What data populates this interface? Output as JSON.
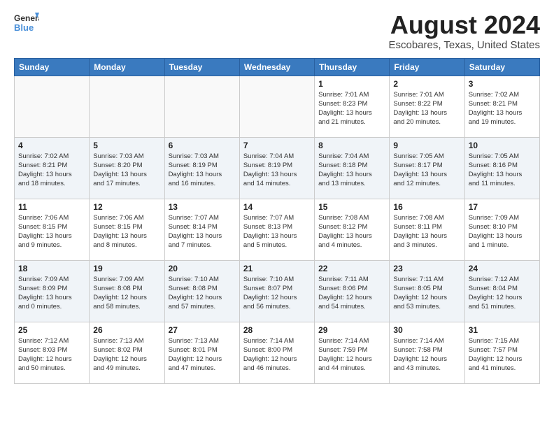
{
  "header": {
    "logo_general": "General",
    "logo_blue": "Blue",
    "title": "August 2024",
    "subtitle": "Escobares, Texas, United States"
  },
  "days_of_week": [
    "Sunday",
    "Monday",
    "Tuesday",
    "Wednesday",
    "Thursday",
    "Friday",
    "Saturday"
  ],
  "weeks": [
    [
      {
        "day": "",
        "info": ""
      },
      {
        "day": "",
        "info": ""
      },
      {
        "day": "",
        "info": ""
      },
      {
        "day": "",
        "info": ""
      },
      {
        "day": "1",
        "info": "Sunrise: 7:01 AM\nSunset: 8:23 PM\nDaylight: 13 hours\nand 21 minutes."
      },
      {
        "day": "2",
        "info": "Sunrise: 7:01 AM\nSunset: 8:22 PM\nDaylight: 13 hours\nand 20 minutes."
      },
      {
        "day": "3",
        "info": "Sunrise: 7:02 AM\nSunset: 8:21 PM\nDaylight: 13 hours\nand 19 minutes."
      }
    ],
    [
      {
        "day": "4",
        "info": "Sunrise: 7:02 AM\nSunset: 8:21 PM\nDaylight: 13 hours\nand 18 minutes."
      },
      {
        "day": "5",
        "info": "Sunrise: 7:03 AM\nSunset: 8:20 PM\nDaylight: 13 hours\nand 17 minutes."
      },
      {
        "day": "6",
        "info": "Sunrise: 7:03 AM\nSunset: 8:19 PM\nDaylight: 13 hours\nand 16 minutes."
      },
      {
        "day": "7",
        "info": "Sunrise: 7:04 AM\nSunset: 8:19 PM\nDaylight: 13 hours\nand 14 minutes."
      },
      {
        "day": "8",
        "info": "Sunrise: 7:04 AM\nSunset: 8:18 PM\nDaylight: 13 hours\nand 13 minutes."
      },
      {
        "day": "9",
        "info": "Sunrise: 7:05 AM\nSunset: 8:17 PM\nDaylight: 13 hours\nand 12 minutes."
      },
      {
        "day": "10",
        "info": "Sunrise: 7:05 AM\nSunset: 8:16 PM\nDaylight: 13 hours\nand 11 minutes."
      }
    ],
    [
      {
        "day": "11",
        "info": "Sunrise: 7:06 AM\nSunset: 8:15 PM\nDaylight: 13 hours\nand 9 minutes."
      },
      {
        "day": "12",
        "info": "Sunrise: 7:06 AM\nSunset: 8:15 PM\nDaylight: 13 hours\nand 8 minutes."
      },
      {
        "day": "13",
        "info": "Sunrise: 7:07 AM\nSunset: 8:14 PM\nDaylight: 13 hours\nand 7 minutes."
      },
      {
        "day": "14",
        "info": "Sunrise: 7:07 AM\nSunset: 8:13 PM\nDaylight: 13 hours\nand 5 minutes."
      },
      {
        "day": "15",
        "info": "Sunrise: 7:08 AM\nSunset: 8:12 PM\nDaylight: 13 hours\nand 4 minutes."
      },
      {
        "day": "16",
        "info": "Sunrise: 7:08 AM\nSunset: 8:11 PM\nDaylight: 13 hours\nand 3 minutes."
      },
      {
        "day": "17",
        "info": "Sunrise: 7:09 AM\nSunset: 8:10 PM\nDaylight: 13 hours\nand 1 minute."
      }
    ],
    [
      {
        "day": "18",
        "info": "Sunrise: 7:09 AM\nSunset: 8:09 PM\nDaylight: 13 hours\nand 0 minutes."
      },
      {
        "day": "19",
        "info": "Sunrise: 7:09 AM\nSunset: 8:08 PM\nDaylight: 12 hours\nand 58 minutes."
      },
      {
        "day": "20",
        "info": "Sunrise: 7:10 AM\nSunset: 8:08 PM\nDaylight: 12 hours\nand 57 minutes."
      },
      {
        "day": "21",
        "info": "Sunrise: 7:10 AM\nSunset: 8:07 PM\nDaylight: 12 hours\nand 56 minutes."
      },
      {
        "day": "22",
        "info": "Sunrise: 7:11 AM\nSunset: 8:06 PM\nDaylight: 12 hours\nand 54 minutes."
      },
      {
        "day": "23",
        "info": "Sunrise: 7:11 AM\nSunset: 8:05 PM\nDaylight: 12 hours\nand 53 minutes."
      },
      {
        "day": "24",
        "info": "Sunrise: 7:12 AM\nSunset: 8:04 PM\nDaylight: 12 hours\nand 51 minutes."
      }
    ],
    [
      {
        "day": "25",
        "info": "Sunrise: 7:12 AM\nSunset: 8:03 PM\nDaylight: 12 hours\nand 50 minutes."
      },
      {
        "day": "26",
        "info": "Sunrise: 7:13 AM\nSunset: 8:02 PM\nDaylight: 12 hours\nand 49 minutes."
      },
      {
        "day": "27",
        "info": "Sunrise: 7:13 AM\nSunset: 8:01 PM\nDaylight: 12 hours\nand 47 minutes."
      },
      {
        "day": "28",
        "info": "Sunrise: 7:14 AM\nSunset: 8:00 PM\nDaylight: 12 hours\nand 46 minutes."
      },
      {
        "day": "29",
        "info": "Sunrise: 7:14 AM\nSunset: 7:59 PM\nDaylight: 12 hours\nand 44 minutes."
      },
      {
        "day": "30",
        "info": "Sunrise: 7:14 AM\nSunset: 7:58 PM\nDaylight: 12 hours\nand 43 minutes."
      },
      {
        "day": "31",
        "info": "Sunrise: 7:15 AM\nSunset: 7:57 PM\nDaylight: 12 hours\nand 41 minutes."
      }
    ]
  ]
}
